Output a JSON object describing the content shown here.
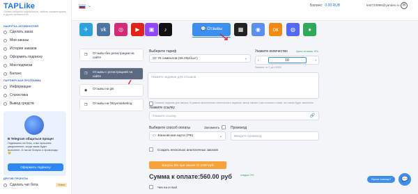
{
  "brand": {
    "name": "TAPLike",
    "tagline": "Сервис накрутки подписчиков, лайков, комментариев и других активностей"
  },
  "header": {
    "flag": "RU",
    "balance_label": "Баланс:",
    "balance_value": "0.00 RUB",
    "email": "test723999@yandex.ru"
  },
  "sidebar": {
    "section1": "Накрутка активностей",
    "items1": [
      "Сделать заказ",
      "Мои заказы",
      "История заказов",
      "Оформить подписку",
      "Мои подписки",
      "Баланс"
    ],
    "section2": "Партнерская программа",
    "items2": [
      "Информация",
      "Статистика",
      "Вывод средств"
    ],
    "tg_title": "В Telegram общаться проще!",
    "tg_text": "Подпишись на бота, и мы пришлем уведомление, когда заказ будет выполнен. А так же бонусы и промокоды 🥳",
    "tg_button": "Оформить подписку",
    "section3": "Другие проекты",
    "bottom_item": "Сделать чат бота",
    "bottom_badge": "Новое",
    "bottom_item2": "..."
  },
  "platforms": [
    {
      "name": "telegram",
      "color": "#2aa3e0",
      "glyph": "✈"
    },
    {
      "name": "vk",
      "color": "#4c75a3",
      "glyph": "vk"
    },
    {
      "name": "instagram",
      "color": "#d62a77",
      "glyph": "◎"
    },
    {
      "name": "youtube",
      "color": "#e62117",
      "glyph": "▶"
    },
    {
      "name": "twitch",
      "color": "#9146ff",
      "glyph": "▣"
    },
    {
      "name": "tiktok",
      "color": "#111111",
      "glyph": "♪"
    },
    {
      "name": "reviews",
      "label": "Отзывы",
      "color": "#3c8ef0",
      "glyph": "💬",
      "active": true
    },
    {
      "name": "yandex-zen",
      "color": "#222222",
      "glyph": "▦"
    },
    {
      "name": "discord",
      "color": "#5b8ef0",
      "glyph": "◉"
    },
    {
      "name": "odnoklassniki",
      "color": "#f28a0f",
      "glyph": "ок"
    },
    {
      "name": "likee",
      "color": "#5468ff",
      "glyph": "◍"
    },
    {
      "name": "green-service",
      "color": "#2daa5a",
      "glyph": "●"
    }
  ],
  "services": [
    {
      "label": "Отзывы без регистрации на сайте",
      "icon": "comment-icon"
    },
    {
      "label": "Отзывы с регистрацией на сайте",
      "icon": "comment-icon",
      "active": true
    },
    {
      "label": "Отзывы на gis",
      "icon": "eye-icon"
    },
    {
      "label": "Отзывы на Otzyvmarketing",
      "icon": "comment-icon"
    }
  ],
  "form": {
    "tariff_label": "Выберите тариф",
    "tariff_value": "От 75 символов (56.00р/1шт)",
    "qty_label": "Укажите количество",
    "qty_link": "Цена отзыва: 5%",
    "qty_value": "10",
    "qty_limits": "Лимиты: от 1 до 10000",
    "textarea_placeholder": "Укажите задание для отзывов",
    "checkbox_text": "Описать задание для автора. В рамках выполнения технического задания, автор сможет сам сочинить отзыв, это заказ будет выполнен",
    "link_label": "Укажите ссылку",
    "link_placeholder": "Укажите ссылку",
    "payment_label": "Выберите способ оплаты",
    "remember_label": "Запомнить",
    "payment_value": "Банковская карта (РФ)",
    "promo_label": "Промокод",
    "promo_placeholder": "Введите промокод",
    "multi_label": "Создать несколько аналогичных заказов",
    "bonus_text": "Бонусы 5% при заказе от 1000 руб",
    "total_label": "Сумма к оплате:",
    "total_value": "560.00 руб",
    "total_discount": "скидка 0%",
    "email_check": "Чек на e-mail"
  },
  "help": {
    "label": "Нужна помощь?"
  }
}
